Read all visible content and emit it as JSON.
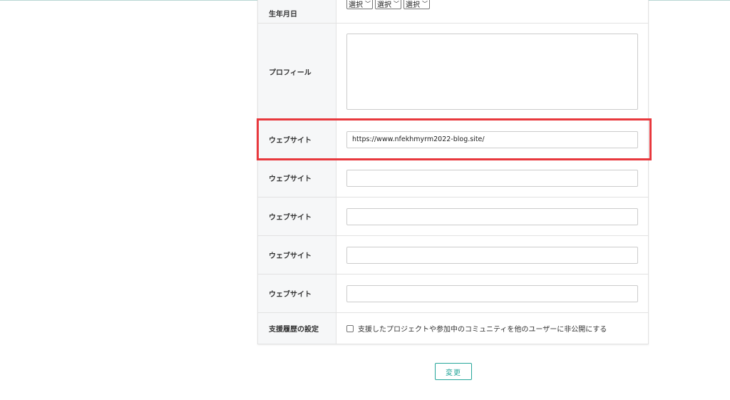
{
  "form": {
    "birthdate": {
      "label": "生年月日",
      "selects": [
        "選択",
        "選択",
        "選択"
      ]
    },
    "profile": {
      "label": "プロフィール",
      "value": ""
    },
    "websites": [
      {
        "label": "ウェブサイト",
        "value": "https://www.nfekhmyrm2022-blog.site/"
      },
      {
        "label": "ウェブサイト",
        "value": ""
      },
      {
        "label": "ウェブサイト",
        "value": ""
      },
      {
        "label": "ウェブサイト",
        "value": ""
      },
      {
        "label": "ウェブサイト",
        "value": ""
      }
    ],
    "support_history": {
      "label": "支援履歴の設定",
      "checkbox_label": "支援したプロジェクトや参加中のコミュニティを他のユーザーに非公開にする",
      "checked": false
    }
  },
  "submit": {
    "label": "変更"
  },
  "colors": {
    "accent": "#26a69a",
    "highlight": "#e8383d",
    "label_bg": "#f6f7f8"
  }
}
